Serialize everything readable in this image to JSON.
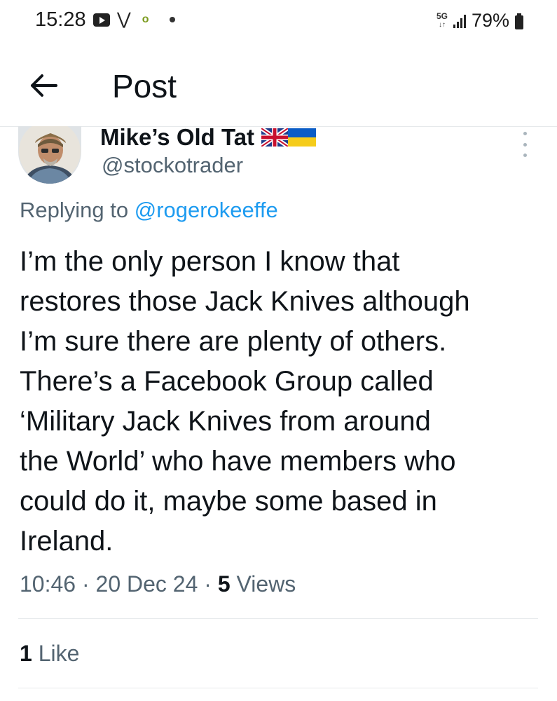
{
  "status_bar": {
    "time": "15:28",
    "network": "5G",
    "battery": "79%",
    "icons": [
      "youtube-icon",
      "v-app-icon",
      "o-app-icon",
      "notification-dot-icon",
      "signal-icon",
      "battery-icon"
    ]
  },
  "header": {
    "title": "Post",
    "back_icon": "arrow-left-icon"
  },
  "post": {
    "display_name": "Mike’s Old Tat",
    "flags": [
      "uk-flag",
      "ukraine-flag"
    ],
    "handle": "@stockotrader",
    "replying_prefix": "Replying to",
    "replying_to": "@rogerokeeffe",
    "text_lines": [
      "I’m the only person I know that",
      "restores those Jack Knives although",
      "I’m sure there are plenty of others.",
      "There’s a Facebook Group called",
      "‘Military Jack Knives from around",
      "the World’ who have members who",
      "could do it, maybe some based in",
      "Ireland."
    ],
    "time": "10:46",
    "separator": "·",
    "date": "20 Dec 24",
    "views_count": "5",
    "views_label": "Views",
    "likes_count": "1",
    "likes_label": "Like"
  },
  "colors": {
    "link": "#1d9bf0",
    "secondary_text": "#536471",
    "primary_text": "#0f1419",
    "divider": "#e6e9eb"
  }
}
